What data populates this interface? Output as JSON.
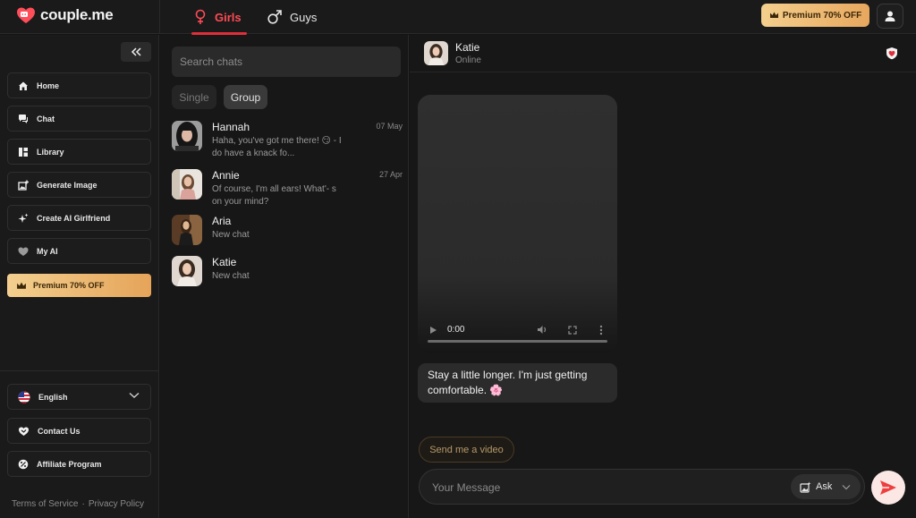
{
  "app": {
    "name": "couple.me"
  },
  "header": {
    "tabs": [
      {
        "label": "Girls",
        "active": true
      },
      {
        "label": "Guys",
        "active": false
      }
    ],
    "premium_label": "Premium 70% OFF"
  },
  "sidebar": {
    "items": [
      {
        "label": "Home",
        "icon": "home-icon"
      },
      {
        "label": "Chat",
        "icon": "chat-icon"
      },
      {
        "label": "Library",
        "icon": "library-icon"
      },
      {
        "label": "Generate Image",
        "icon": "image-plus-icon"
      },
      {
        "label": "Create AI Girlfriend",
        "icon": "sparkle-icon"
      },
      {
        "label": "My AI",
        "icon": "heart-icon"
      }
    ],
    "premium_label": "Premium 70% OFF",
    "language": "English",
    "contact_label": "Contact Us",
    "affiliate_label": "Affiliate Program",
    "terms": "Terms of Service",
    "separator": "·",
    "privacy": "Privacy Policy"
  },
  "chat_list": {
    "search_placeholder": "Search chats",
    "filters": [
      "Single",
      "Group"
    ],
    "chats": [
      {
        "name": "Hannah",
        "date": "07 May",
        "preview": "Haha, you've got me there! 😏 - I do have a knack fo..."
      },
      {
        "name": "Annie",
        "date": "27 Apr",
        "preview": "Of course, I'm all ears! What'- s on your mind?"
      },
      {
        "name": "Aria",
        "date": "",
        "preview": "New chat"
      },
      {
        "name": "Katie",
        "date": "",
        "preview": "New chat"
      }
    ]
  },
  "conversation": {
    "name": "Katie",
    "status": "Online",
    "video_time": "0:00",
    "message": "Stay a little longer. I'm just getting comfortable. 🌸",
    "suggestion": "Send me a video",
    "input_placeholder": "Your Message",
    "ask_label": "Ask"
  },
  "colors": {
    "accent": "#e02f3a",
    "premium_gold": "#e7a75e",
    "background": "#171717"
  }
}
